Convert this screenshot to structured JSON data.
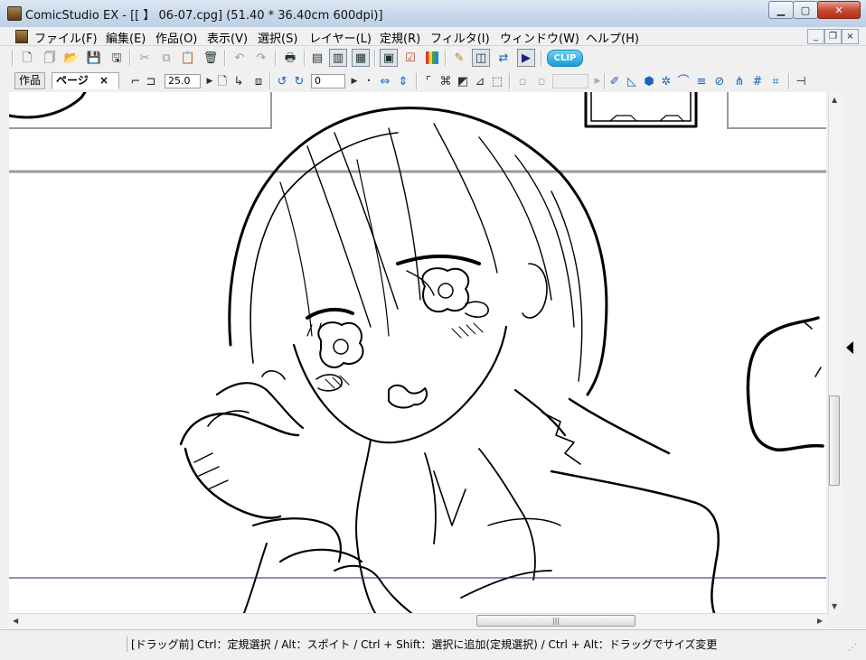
{
  "window": {
    "title": "ComicStudio EX - [[ 】 06-07.cpg] (51.40 * 36.40cm 600dpi)]",
    "controls": {
      "minimize": "▁",
      "maximize": "▢",
      "close": "✕"
    }
  },
  "menubar": {
    "items": [
      "ファイル(F)",
      "編集(E)",
      "作品(O)",
      "表示(V)",
      "選択(S)",
      "レイヤー(L)",
      "定規(R)",
      "フィルタ(I)",
      "ウィンドウ(W)",
      "ヘルプ(H)"
    ],
    "mdi_controls": {
      "minimize": "_",
      "restore": "❐",
      "close": "×"
    }
  },
  "toolbar1": {
    "icons": [
      "new-page-icon",
      "new-story-icon",
      "open-icon",
      "save-icon",
      "save-all-icon",
      "cut-icon",
      "copy-icon",
      "paste-icon",
      "delete-icon",
      "undo-icon",
      "redo-icon",
      "print-icon",
      "page-manager-icon",
      "page-view-icon",
      "spread-view-icon",
      "properties-icon",
      "check-icon",
      "palette-icon",
      "tool-icon",
      "window-icon",
      "swap-icon",
      "play-icon",
      "clip-studio-icon"
    ],
    "clip_badge": "CLIP"
  },
  "toolbar2": {
    "tabs": [
      {
        "label": "作品"
      },
      {
        "label": "ページ",
        "close": "×"
      }
    ],
    "zoom_value": "25.0",
    "rotation_value": "0"
  },
  "statusbar": {
    "text": "[ドラッグ前] Ctrl：定規選択 / Alt：スポイト / Ctrl + Shift：選択に追加(定規選択) / Ctrl + Alt：ドラッグでサイズ変更"
  },
  "colors": {
    "titlebar": "#c8d7ea",
    "chrome": "#f0f0f0",
    "close_button": "#c64a33",
    "frame_line": "#1a237e"
  }
}
